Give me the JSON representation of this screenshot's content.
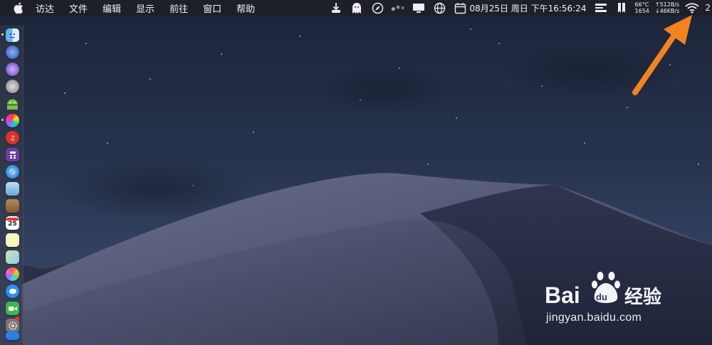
{
  "menubar": {
    "items": [
      "访达",
      "文件",
      "编辑",
      "显示",
      "前往",
      "窗口",
      "帮助"
    ],
    "status": {
      "datetime": "08月25日 周日 下午16:56:24",
      "temperature": "66°C",
      "fan_rpm": "1654",
      "upload_speed": "↑512B/s",
      "download_speed": "↓46KB/s",
      "edge_text": "2",
      "icons": [
        "download-icon",
        "ghost-icon",
        "compass-icon",
        "dots-icon",
        "display-icon",
        "globe-icon",
        "calendar-icon",
        "menu-bars-icon",
        "bookmark-icon",
        "wifi-icon"
      ]
    }
  },
  "dock": {
    "apps": [
      "finder",
      "siri",
      "launchpad",
      "android",
      "colorsync",
      "music-app",
      "calculator",
      "safari",
      "preview",
      "notes-brown",
      "calendar",
      "notes",
      "maps",
      "photos",
      "messages",
      "facetime",
      "system-preferences",
      "keynote"
    ],
    "calendar_day": "25"
  },
  "annotation": {
    "arrow_color": "#f58220"
  },
  "watermark": {
    "brand_left": "Bai",
    "brand_right": "经验",
    "url": "jingyan.baidu.com"
  }
}
